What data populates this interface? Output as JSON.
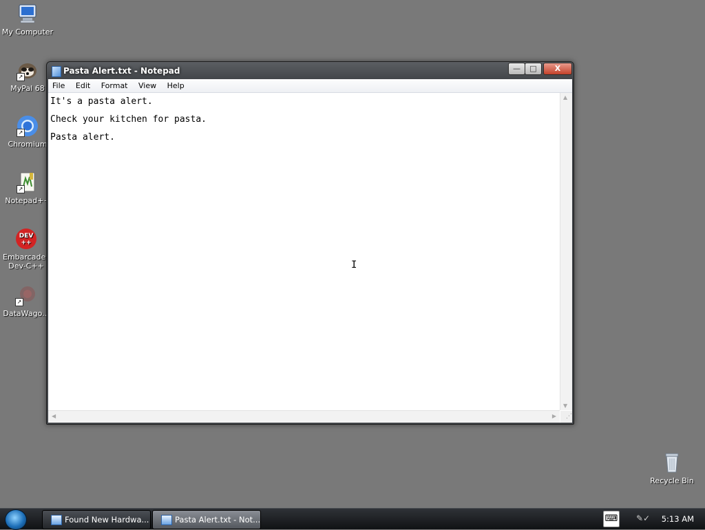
{
  "desktop": {
    "icons": [
      {
        "label": "My Computer"
      },
      {
        "label": "MyPal 68"
      },
      {
        "label": "Chromium"
      },
      {
        "label": "Notepad++"
      },
      {
        "label": "Embarcadero Dev-C++"
      },
      {
        "label": "DataWago..."
      },
      {
        "label": "Recycle Bin"
      }
    ]
  },
  "window": {
    "title": "Pasta Alert.txt - Notepad",
    "menu": [
      "File",
      "Edit",
      "Format",
      "View",
      "Help"
    ],
    "content": "It's a pasta alert.\nCheck your kitchen for pasta.\nPasta alert.",
    "controls": {
      "minimize": "—",
      "maximize": "□",
      "close": "X"
    }
  },
  "taskbar": {
    "buttons": [
      {
        "label": "Found New Hardwa..."
      },
      {
        "label": "Pasta Alert.txt - Not..."
      }
    ],
    "clock": "5:13 AM"
  },
  "colors": {
    "desktop_bg": "#797979",
    "titlebar": "#45484c",
    "close_button": "#c3412a"
  }
}
